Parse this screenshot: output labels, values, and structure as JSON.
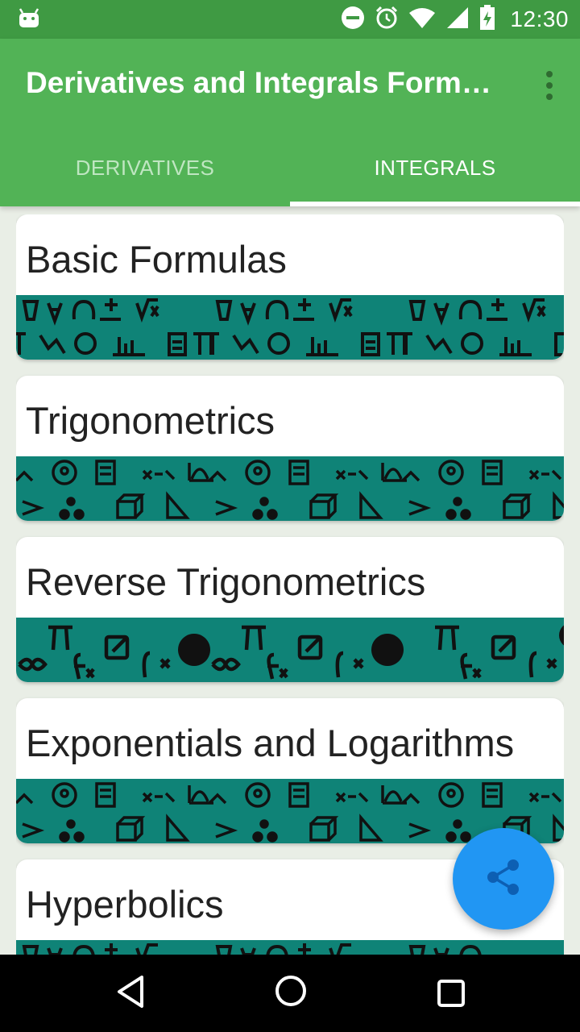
{
  "status_bar": {
    "time": "12:30",
    "icons": [
      "android-icon",
      "do-not-disturb-icon",
      "alarm-icon",
      "wifi-icon",
      "cell-signal-icon",
      "battery-charging-icon"
    ]
  },
  "app_bar": {
    "title": "Derivatives and Integrals Formulas",
    "overflow_icon": "more-vert-icon"
  },
  "tabs": [
    {
      "label": "DERIVATIVES",
      "selected": false
    },
    {
      "label": "INTEGRALS",
      "selected": true
    }
  ],
  "cards": [
    {
      "label": "Basic Formulas",
      "banner": "banner-a"
    },
    {
      "label": "Trigonometrics",
      "banner": "banner-b"
    },
    {
      "label": "Reverse Trigonometrics",
      "banner": "banner-c"
    },
    {
      "label": "Exponentials and Logarithms",
      "banner": "banner-b"
    },
    {
      "label": "Hyperbolics",
      "banner": "banner-a"
    }
  ],
  "fab": {
    "icon": "share-icon"
  },
  "nav_bar": {
    "icons": [
      "back-icon",
      "home-icon",
      "recents-icon"
    ]
  },
  "colors": {
    "status_bar": "#3f9a43",
    "app_bar": "#52b356",
    "banner": "#0f8377",
    "fab": "#2196f3"
  }
}
